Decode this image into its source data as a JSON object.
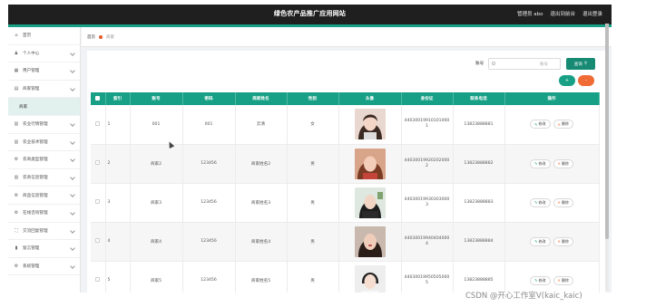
{
  "app": {
    "title": "绿色农产品推广应用网站",
    "admin_label": "管理员 abo",
    "exit_admin": "退出到前台",
    "logout": "退出登录"
  },
  "sidebar": {
    "items": [
      {
        "icon": "home-icon",
        "label": "首页",
        "has_chevron": false
      },
      {
        "icon": "user-icon",
        "label": "个人中心",
        "has_chevron": true
      },
      {
        "icon": "users-icon",
        "label": "用户管理",
        "has_chevron": true
      },
      {
        "icon": "store-icon",
        "label": "商家管理",
        "has_chevron": true
      },
      {
        "icon": "",
        "label": "商家",
        "sub": true
      },
      {
        "icon": "grid-icon",
        "label": "农业行情管理",
        "has_chevron": true
      },
      {
        "icon": "grid-icon",
        "label": "农业技术管理",
        "has_chevron": true
      },
      {
        "icon": "gear-icon",
        "label": "农商类型管理",
        "has_chevron": true
      },
      {
        "icon": "grid-icon",
        "label": "农商信息管理",
        "has_chevron": true
      },
      {
        "icon": "gear-icon",
        "label": "商品信息管理",
        "has_chevron": true
      },
      {
        "icon": "gear-icon",
        "label": "在线咨询管理",
        "has_chevron": true
      },
      {
        "icon": "expand-icon",
        "label": "交流回复管理",
        "has_chevron": true
      },
      {
        "icon": "chart-icon",
        "label": "留言管理",
        "has_chevron": true
      },
      {
        "icon": "gear-icon",
        "label": "系统管理",
        "has_chevron": true
      }
    ]
  },
  "breadcrumb": {
    "home": "首页",
    "current": "商家"
  },
  "search": {
    "label": "账号",
    "placeholder": "账号",
    "button": "查询"
  },
  "actions": {
    "add": "+",
    "delete": "-"
  },
  "table": {
    "headers": [
      "",
      "索引",
      "账号",
      "密码",
      "商家姓名",
      "性别",
      "头像",
      "身份证",
      "联系电话",
      "操作"
    ],
    "rows": [
      {
        "index": "1",
        "account": "001",
        "password": "001",
        "name": "云清",
        "gender": "女",
        "id_card": "440300199101010001",
        "phone": "13823888881"
      },
      {
        "index": "2",
        "account": "商家2",
        "password": "123456",
        "name": "商家姓名2",
        "gender": "男",
        "id_card": "440300199202020002",
        "phone": "13823888882"
      },
      {
        "index": "3",
        "account": "商家3",
        "password": "123456",
        "name": "商家姓名3",
        "gender": "男",
        "id_card": "440300199303030003",
        "phone": "13823888883"
      },
      {
        "index": "4",
        "account": "商家4",
        "password": "123456",
        "name": "商家姓名4",
        "gender": "男",
        "id_card": "440300199404040004",
        "phone": "13823888884"
      },
      {
        "index": "5",
        "account": "商家5",
        "password": "123456",
        "name": "商家姓名5",
        "gender": "男",
        "id_card": "440300199505050005",
        "phone": "13823888885"
      }
    ],
    "row_actions": {
      "edit": "修改",
      "delete": "删除"
    }
  },
  "watermark": "CSDN @开心工作室V(kaic_kaic)",
  "colors": {
    "brand": "#17a085",
    "danger": "#f06a35",
    "topbar": "#1f1f1f"
  }
}
